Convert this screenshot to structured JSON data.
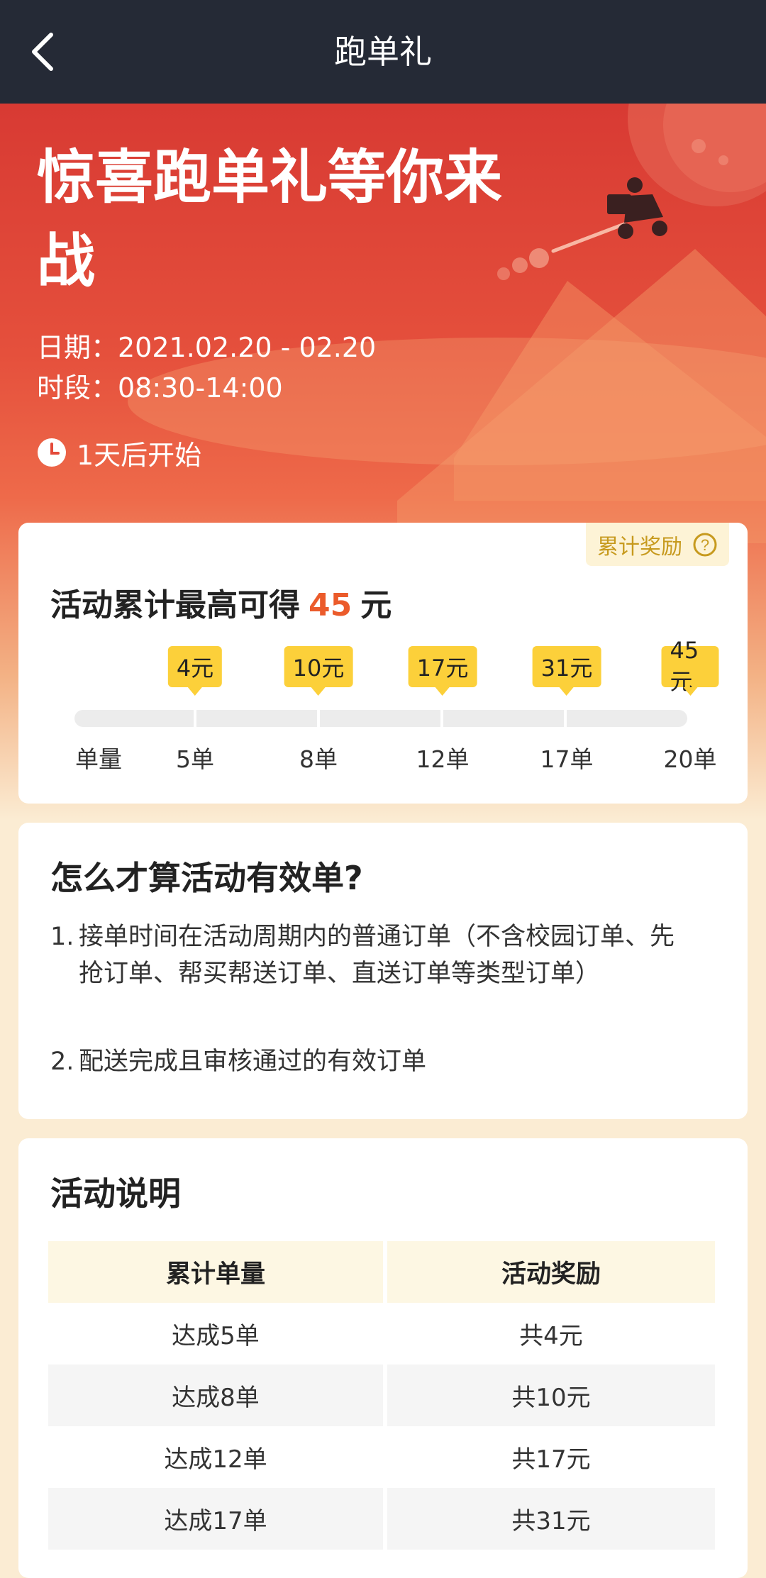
{
  "nav": {
    "title": "跑单礼"
  },
  "hero": {
    "title": "惊喜跑单礼等你来战",
    "date": "日期：2021.02.20 - 02.20",
    "time": "时段：08:30-14:00",
    "countdown": "1天后开始"
  },
  "reward_card": {
    "badge_label": "累计奖励",
    "title_prefix": "活动累计最高可得",
    "max_amount": "45",
    "title_suffix": "元",
    "start_label": "单量",
    "milestones": [
      {
        "orders": "5单",
        "reward": "4元"
      },
      {
        "orders": "8单",
        "reward": "10元"
      },
      {
        "orders": "12单",
        "reward": "17元"
      },
      {
        "orders": "17单",
        "reward": "31元"
      },
      {
        "orders": "20单",
        "reward": "45元"
      }
    ]
  },
  "valid_order_card": {
    "title": "怎么才算活动有效单?",
    "rules": [
      {
        "num": "1.",
        "text": "接单时间在活动周期内的普通订单（不含校园订单、先抢订单、帮买帮送订单、直送订单等类型订单）"
      },
      {
        "num": "2.",
        "text": "配送完成且审核通过的有效订单"
      }
    ]
  },
  "description_card": {
    "title": "活动说明",
    "headers": [
      "累计单量",
      "活动奖励"
    ],
    "rows": [
      [
        "达成5单",
        "共4元"
      ],
      [
        "达成8单",
        "共10元"
      ],
      [
        "达成12单",
        "共17元"
      ],
      [
        "达成17单",
        "共31元"
      ]
    ]
  },
  "colors": {
    "nav_bg": "#252a36",
    "hero_red": "#d83a33",
    "accent_amount": "#eb5b2b",
    "tag_yellow": "#fcd03a",
    "page_bg": "#fbecd3"
  }
}
